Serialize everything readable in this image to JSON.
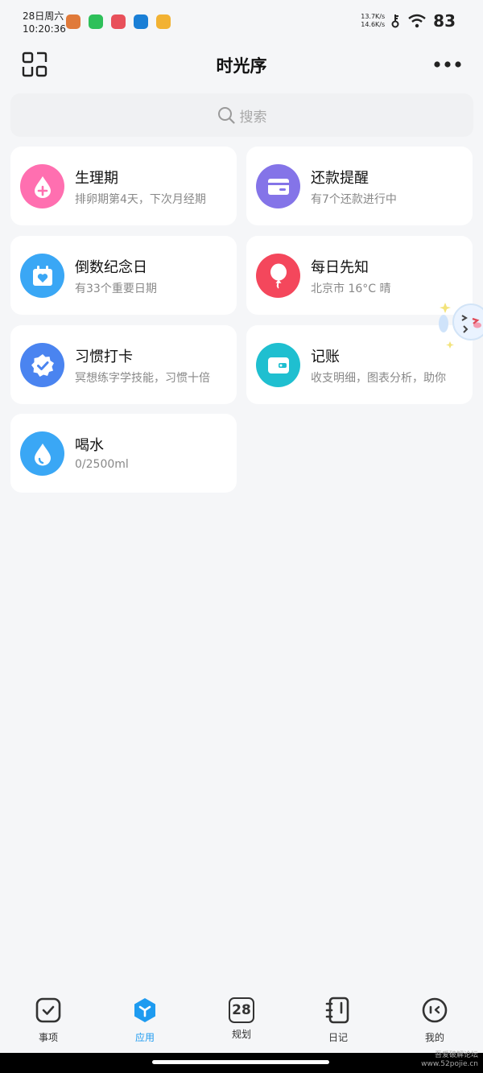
{
  "status_bar": {
    "date": "28日周六",
    "time": "10:20:36",
    "speed_up": "13.7K/s",
    "speed_down": "14.6K/s",
    "battery": "83"
  },
  "header": {
    "title": "时光序"
  },
  "search": {
    "placeholder": "搜索"
  },
  "cards": [
    {
      "title": "生理期",
      "subtitle": "排卵期第4天，下次月经期",
      "color": "#ff6fb0"
    },
    {
      "title": "还款提醒",
      "subtitle": "有7个还款进行中",
      "color": "#8474e8"
    },
    {
      "title": "倒数纪念日",
      "subtitle": "有33个重要日期",
      "color": "#3aa7f5"
    },
    {
      "title": "每日先知",
      "subtitle": "北京市 16°C 晴",
      "color": "#f4475c"
    },
    {
      "title": "习惯打卡",
      "subtitle": "冥想练字学技能，习惯十倍",
      "color": "#4a84f0"
    },
    {
      "title": "记账",
      "subtitle": "收支明细，图表分析，助你",
      "color": "#1fbfd0"
    },
    {
      "title": "喝水",
      "subtitle": "0/2500ml",
      "color": "#3aa7f5"
    }
  ],
  "bottom_nav": [
    {
      "label": "事项",
      "active": false
    },
    {
      "label": "应用",
      "active": true
    },
    {
      "label": "规划",
      "active": false,
      "badge": "28"
    },
    {
      "label": "日记",
      "active": false
    },
    {
      "label": "我的",
      "active": false
    }
  ],
  "watermark": {
    "line1": "吾爱破解论坛",
    "line2": "www.52pojie.cn"
  },
  "colors": {
    "accent": "#1e9bf0",
    "background": "#f5f6f8"
  }
}
